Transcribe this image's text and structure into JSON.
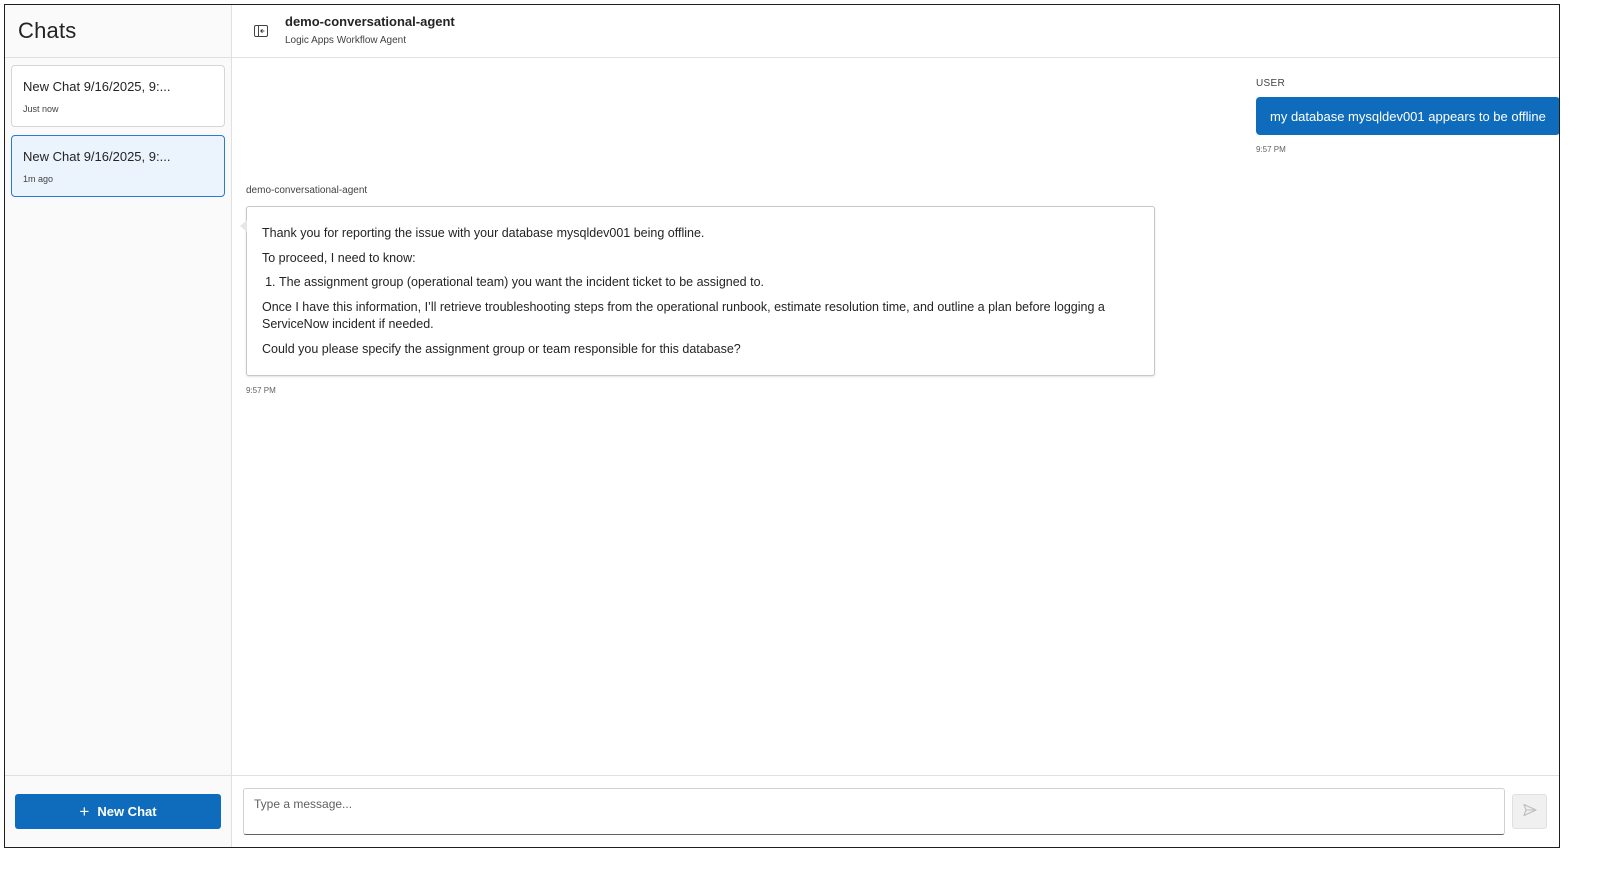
{
  "sidebar": {
    "title": "Chats",
    "chats": [
      {
        "title": "New Chat 9/16/2025, 9:...",
        "time": "Just now",
        "active": false
      },
      {
        "title": "New Chat 9/16/2025, 9:...",
        "time": "1m ago",
        "active": true
      }
    ],
    "new_chat_label": "New Chat"
  },
  "header": {
    "agent_name": "demo-conversational-agent",
    "subtitle": "Logic Apps Workflow Agent",
    "toggle_icon": "panel-collapse-icon"
  },
  "conversation": {
    "user_message": {
      "sender": "USER",
      "text": "my database mysqldev001 appears to be offline",
      "time": "9:57 PM"
    },
    "agent_message": {
      "sender": "demo-conversational-agent",
      "p1": "Thank you for reporting the issue with your database mysqldev001 being offline.",
      "p2": "To proceed, I need to know:",
      "list_item_1": "The assignment group (operational team) you want the incident ticket to be assigned to.",
      "p3": "Once I have this information, I’ll retrieve troubleshooting steps from the operational runbook, estimate resolution time, and outline a plan before logging a ServiceNow incident if needed.",
      "p4": "Could you please specify the assignment group or team responsible for this database?",
      "time": "9:57 PM"
    }
  },
  "composer": {
    "placeholder": "Type a message...",
    "send_icon": "send-icon"
  },
  "colors": {
    "accent": "#0f6cbd",
    "active_chat_bg": "#ebf3fc",
    "active_chat_border": "#2a7ad0"
  }
}
